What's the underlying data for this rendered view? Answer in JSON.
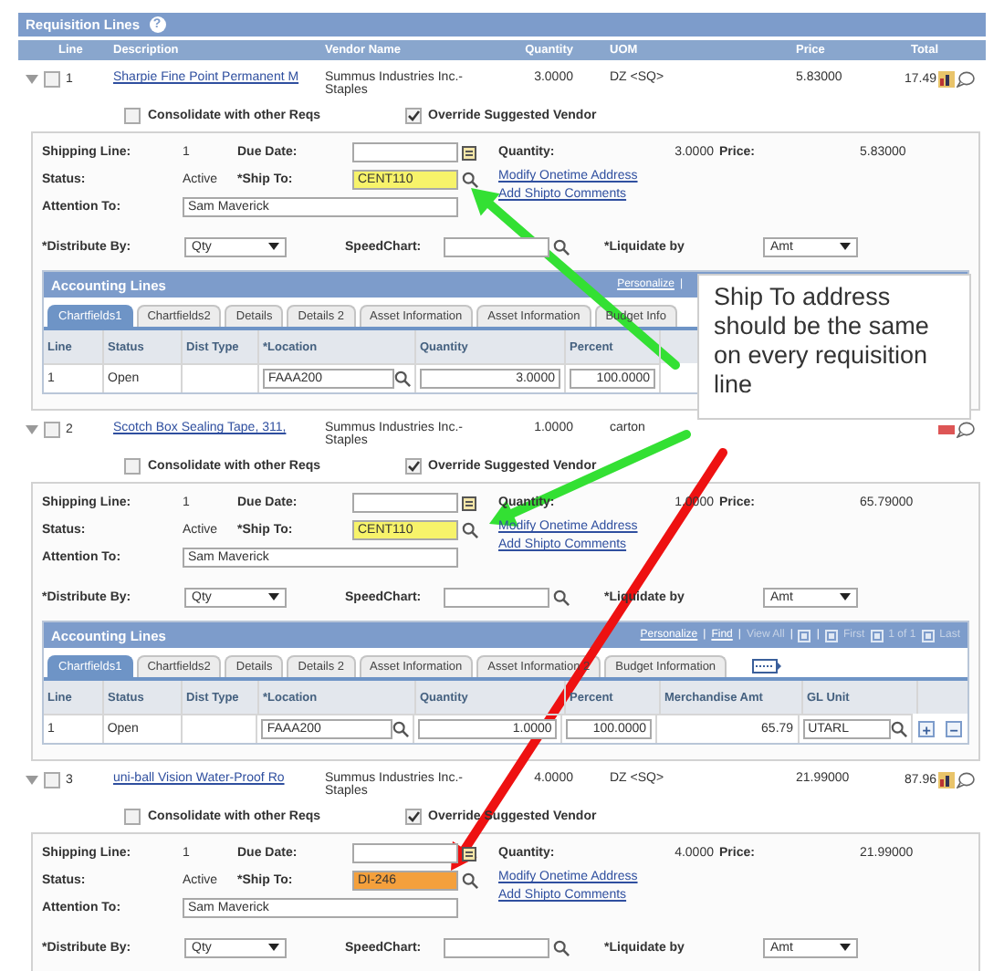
{
  "section": {
    "title": "Requisition Lines",
    "help": "?"
  },
  "columns": [
    "Line",
    "Description",
    "Vendor Name",
    "Quantity",
    "UOM",
    "Price",
    "Total"
  ],
  "lines": [
    {
      "line": "1",
      "selected": false,
      "description": "Sharpie Fine Point Permanent M",
      "vendor": "Summus Industries Inc.-",
      "vendor_2": "Staples",
      "quantity": "3.0000",
      "uom": "DZ <SQ>",
      "price": "5.83000",
      "total": "17.49",
      "options": [
        {
          "label": "Consolidate with other Reqs",
          "checked": false
        },
        {
          "label": "Override Suggested Vendor",
          "checked": true
        }
      ],
      "shipping": {
        "shipping_line_label": "Shipping Line:",
        "shipping_line": "1",
        "due_date_label": "Due Date:",
        "quantity_label": "Quantity:",
        "quantity": "3.0000",
        "price_label": "Price:",
        "price": "5.83000",
        "status_label": "Status:",
        "status": "Active",
        "ship_to_label": "*Ship To:",
        "ship_to": {
          "value": "CENT110",
          "color": "#f7f36a"
        },
        "links": [
          "Modify Onetime Address",
          "Add Shipto Comments"
        ],
        "attention_label": "Attention To:",
        "attention": "Sam Maverick"
      },
      "distribute": {
        "distribute_label": "*Distribute By:",
        "distribute": "Qty",
        "speedchart_label": "SpeedChart:",
        "liquidate_label": "*Liquidate by",
        "liquidate": "Amt"
      },
      "accounting": {
        "title": "Accounting Lines",
        "nav": [
          {
            "kind": "link",
            "text": "Personalize"
          },
          {
            "kind": "sep",
            "text": "|"
          }
        ],
        "tabs": [
          {
            "label": "Chartfields1",
            "selected": true
          },
          {
            "label": "Chartfields2",
            "selected": false
          },
          {
            "label": "Details",
            "selected": false
          },
          {
            "label": "Details 2",
            "selected": false
          },
          {
            "label": "Asset Information",
            "selected": false
          },
          {
            "label": "Asset Information",
            "selected": false
          },
          {
            "label": "Budget Info",
            "selected": false
          }
        ],
        "columns": [
          {
            "label": "Line",
            "kind": "text"
          },
          {
            "label": "Status",
            "kind": "text"
          },
          {
            "label": "Dist Type",
            "kind": "text"
          },
          {
            "label": "*Location",
            "kind": "lookup"
          },
          {
            "label": "Quantity",
            "kind": "field"
          },
          {
            "label": "Percent",
            "kind": "field"
          }
        ],
        "rows": [
          {
            "cells": [
              "1",
              "Open",
              "",
              "FAAA200",
              "3.0000",
              "100.0000"
            ]
          }
        ]
      }
    },
    {
      "line": "2",
      "selected": false,
      "description": "Scotch Box Sealing Tape, 311,",
      "vendor": "Summus Industries Inc.-",
      "vendor_2": "Staples",
      "quantity": "1.0000",
      "uom": "carton",
      "options": [
        {
          "label": "Consolidate with other Reqs",
          "checked": false
        },
        {
          "label": "Override Suggested Vendor",
          "checked": true
        }
      ],
      "shipping": {
        "shipping_line_label": "Shipping Line:",
        "shipping_line": "1",
        "due_date_label": "Due Date:",
        "quantity_label": "Quantity:",
        "quantity": "1.0000",
        "price_label": "Price:",
        "price": "65.79000",
        "status_label": "Status:",
        "status": "Active",
        "ship_to_label": "*Ship To:",
        "ship_to": {
          "value": "CENT110",
          "color": "#f7f36a"
        },
        "links": [
          "Modify Onetime Address",
          "Add Shipto Comments"
        ],
        "attention_label": "Attention To:",
        "attention": "Sam Maverick"
      },
      "distribute": {
        "distribute_label": "*Distribute By:",
        "distribute": "Qty",
        "speedchart_label": "SpeedChart:",
        "liquidate_label": "*Liquidate by",
        "liquidate": "Amt"
      },
      "accounting": {
        "title": "Accounting Lines",
        "nav": [
          {
            "kind": "link",
            "text": "Personalize"
          },
          {
            "kind": "sep",
            "text": "|"
          },
          {
            "kind": "link",
            "text": "Find"
          },
          {
            "kind": "sep",
            "text": "|"
          },
          {
            "kind": "disabled",
            "text": "View All"
          },
          {
            "kind": "sep",
            "text": "|"
          },
          {
            "kind": "icon"
          },
          {
            "kind": "sep",
            "text": "|"
          },
          {
            "kind": "icon"
          },
          {
            "kind": "disabled",
            "text": "First"
          },
          {
            "kind": "icon"
          },
          {
            "kind": "disabled",
            "text": "1 of 1"
          },
          {
            "kind": "icon"
          },
          {
            "kind": "disabled",
            "text": "Last"
          }
        ],
        "tabs": [
          {
            "label": "Chartfields1",
            "selected": true
          },
          {
            "label": "Chartfields2",
            "selected": false
          },
          {
            "label": "Details",
            "selected": false
          },
          {
            "label": "Details 2",
            "selected": false
          },
          {
            "label": "Asset Information",
            "selected": false
          },
          {
            "label": "Asset Information 2",
            "selected": false
          },
          {
            "label": "Budget Information",
            "selected": false
          }
        ],
        "columns": [
          {
            "label": "Line",
            "kind": "text"
          },
          {
            "label": "Status",
            "kind": "text"
          },
          {
            "label": "Dist Type",
            "kind": "text"
          },
          {
            "label": "*Location",
            "kind": "lookup"
          },
          {
            "label": "Quantity",
            "kind": "field"
          },
          {
            "label": "Percent",
            "kind": "field"
          },
          {
            "label": "Merchandise Amt",
            "kind": "amount"
          },
          {
            "label": "GL Unit",
            "kind": "lookup"
          }
        ],
        "rows": [
          {
            "cells": [
              "1",
              "Open",
              "",
              "FAAA200",
              "1.0000",
              "100.0000",
              "65.79",
              "UTARL"
            ],
            "actions": [
              "+",
              "−"
            ]
          }
        ]
      }
    },
    {
      "line": "3",
      "selected": false,
      "description": "uni-ball Vision Water-Proof Ro",
      "vendor": "Summus Industries Inc.-",
      "vendor_2": "Staples",
      "quantity": "4.0000",
      "uom": "DZ <SQ>",
      "price": "21.99000",
      "total": "87.96",
      "options": [
        {
          "label": "Consolidate with other Reqs",
          "checked": false
        },
        {
          "label": "Override Suggested Vendor",
          "checked": true
        }
      ],
      "shipping": {
        "shipping_line_label": "Shipping Line:",
        "shipping_line": "1",
        "due_date_label": "Due Date:",
        "quantity_label": "Quantity:",
        "quantity": "4.0000",
        "price_label": "Price:",
        "price": "21.99000",
        "status_label": "Status:",
        "status": "Active",
        "ship_to_label": "*Ship To:",
        "ship_to": {
          "value": "DI-246",
          "color": "#f4a03c"
        },
        "links": [
          "Modify Onetime Address",
          "Add Shipto Comments"
        ],
        "attention_label": "Attention To:",
        "attention": "Sam Maverick"
      },
      "distribute": {
        "distribute_label": "*Distribute By:",
        "distribute": "Qty",
        "speedchart_label": "SpeedChart:",
        "liquidate_label": "*Liquidate by",
        "liquidate": "Amt"
      }
    }
  ],
  "callout": {
    "text": "Ship To address should be the same on every requisition line"
  },
  "arrows": [
    {
      "color": "#33e033"
    },
    {
      "color": "#33e033"
    },
    {
      "color": "#ee1111"
    }
  ]
}
